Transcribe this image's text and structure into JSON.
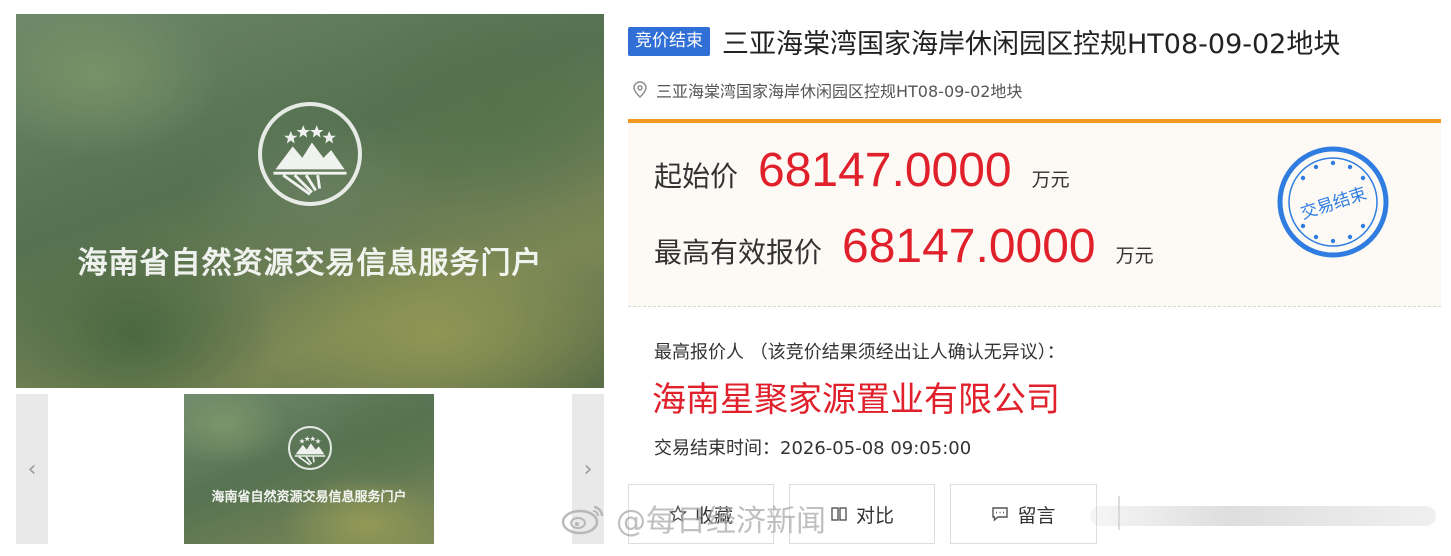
{
  "gallery": {
    "main_caption": "海南省自然资源交易信息服务门户",
    "thumb_caption": "海南省自然资源交易信息服务门户",
    "prev_arrow": "‹",
    "next_arrow": "›"
  },
  "listing": {
    "status_tag": "竞价结束",
    "title": "三亚海棠湾国家海岸休闲园区控规HT08-09-02地块",
    "location": "三亚海棠湾国家海岸休闲园区控规HT08-09-02地块"
  },
  "prices": {
    "start_label": "起始价",
    "start_value": "68147.0000",
    "start_unit": "万元",
    "highest_label": "最高有效报价",
    "highest_value": "68147.0000",
    "highest_unit": "万元"
  },
  "stamp": {
    "text": "交易结束",
    "color": "#2f7de0"
  },
  "result": {
    "bidder_label": "最高报价人 （该竞价结果须经出让人确认无异议）：",
    "bidder_name": "海南星聚家源置业有限公司",
    "end_time": "交易结束时间：2026-05-08 09:05:00"
  },
  "actions": {
    "favorite_label": "收藏",
    "compare_label": "对比",
    "comment_label": "留言"
  },
  "watermark": {
    "text": "@每日经济新闻"
  },
  "colors": {
    "accent_blue": "#2f6fd6",
    "price_red": "#e0202b",
    "orange_border": "#f29a1f"
  }
}
